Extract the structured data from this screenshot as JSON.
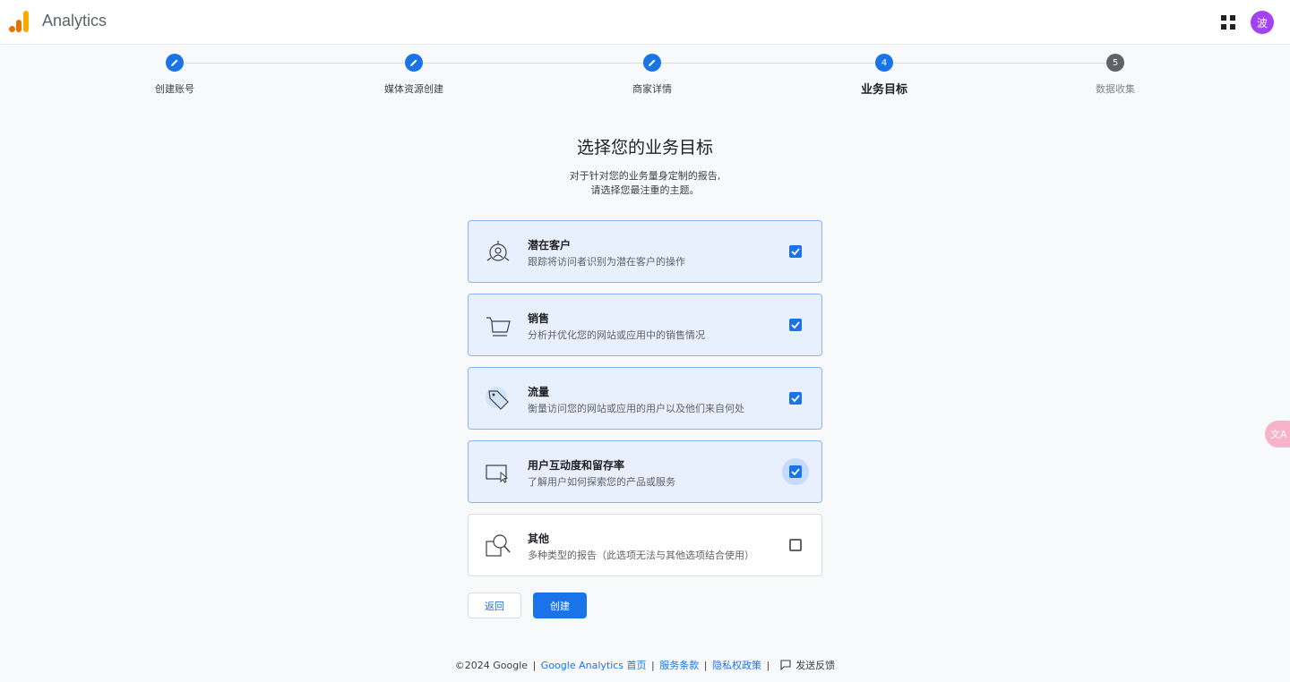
{
  "app": {
    "name": "Analytics",
    "avatar_letter": "波"
  },
  "colors": {
    "accent": "#1a73e8",
    "selected_card_bg": "#e8f0fe",
    "avatar": "#a142f4"
  },
  "stepper": {
    "steps": [
      {
        "number": "",
        "label": "创建账号",
        "state": "done",
        "icon": "pencil-icon"
      },
      {
        "number": "",
        "label": "媒体资源创建",
        "state": "done",
        "icon": "pencil-icon"
      },
      {
        "number": "",
        "label": "商家详情",
        "state": "done",
        "icon": "pencil-icon"
      },
      {
        "number": "4",
        "label": "业务目标",
        "state": "active"
      },
      {
        "number": "5",
        "label": "数据收集",
        "state": "pending"
      }
    ]
  },
  "heading": {
    "title": "选择您的业务目标",
    "subtitle_line1": "对于针对您的业务量身定制的报告,",
    "subtitle_line2": "请选择您最注重的主题。"
  },
  "objectives": [
    {
      "title": "潜在客户",
      "desc": "跟踪将访问者识别为潜在客户的操作",
      "checked": true,
      "icon": "lead-target-icon"
    },
    {
      "title": "销售",
      "desc": "分析并优化您的网站或应用中的销售情况",
      "checked": true,
      "icon": "shopping-cart-icon"
    },
    {
      "title": "流量",
      "desc": "衡量访问您的网站或应用的用户以及他们来自何处",
      "checked": true,
      "icon": "tag-icon"
    },
    {
      "title": "用户互动度和留存率",
      "desc": "了解用户如何探索您的产品或服务",
      "checked": true,
      "icon": "screen-cursor-icon"
    },
    {
      "title": "其他",
      "desc": "多种类型的报告（此选项无法与其他选项结合使用）",
      "checked": false,
      "icon": "magnifier-icon"
    }
  ],
  "actions": {
    "back": "返回",
    "create": "创建"
  },
  "footer": {
    "copyright": "©2024 Google",
    "home_link": "Google Analytics 首页",
    "terms_link": "服务条款",
    "privacy_link": "隐私权政策",
    "feedback": "发送反馈",
    "separator": "|"
  },
  "side_widget": {
    "label": "文A"
  }
}
